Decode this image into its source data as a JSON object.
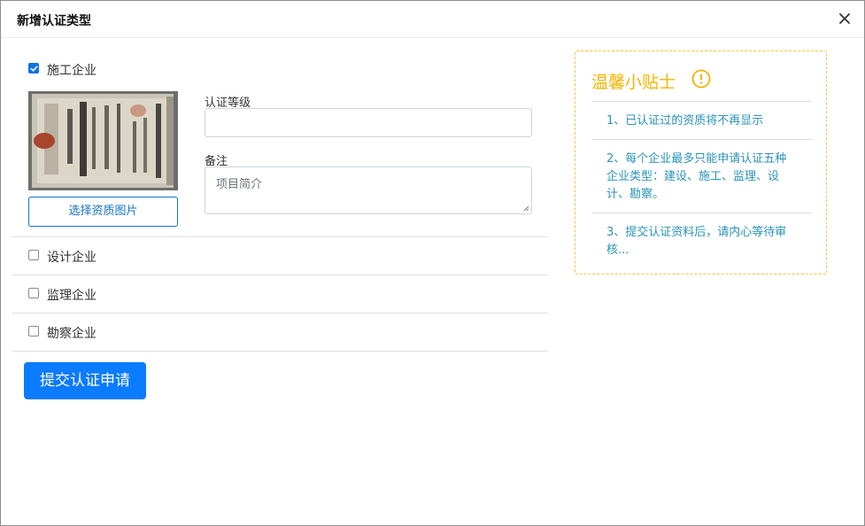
{
  "dialog": {
    "title": "新增认证类型",
    "close_icon": "close-icon"
  },
  "sections": [
    {
      "label": "施工企业",
      "checked": true,
      "choose_button": "选择资质图片",
      "level_label": "认证等级",
      "level_value": "",
      "remark_label": "备注",
      "remark_placeholder": "项目简介"
    },
    {
      "label": "设计企业",
      "checked": false
    },
    {
      "label": "监理企业",
      "checked": false
    },
    {
      "label": "勘察企业",
      "checked": false
    }
  ],
  "submit_label": "提交认证申请",
  "tips": {
    "title": "温馨小贴士",
    "icon": "info-circle-icon",
    "items": [
      "1、已认证过的资质将不再显示",
      "2、每个企业最多只能申请认证五种企业类型：建设、施工、监理、设计、勘察。",
      "3、提交认证资料后，请内心等待审核..."
    ]
  },
  "colors": {
    "primary": "#0b7bff",
    "checkbox": "#0d74e7",
    "tips_title": "#f5b400",
    "tips_border": "#f5c142",
    "tips_text": "#2a93b8"
  }
}
